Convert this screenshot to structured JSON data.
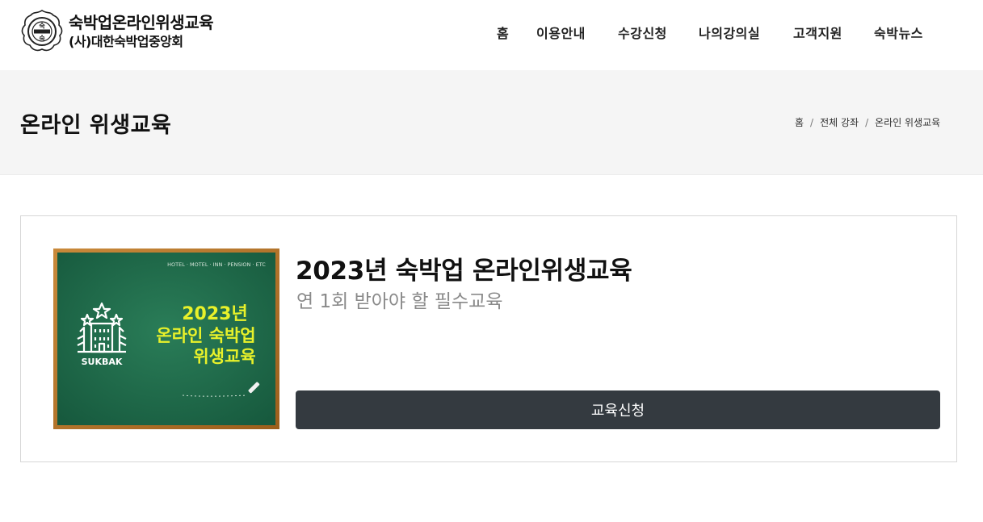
{
  "header": {
    "logo": {
      "line1": "숙박업온라인위생교육",
      "line2": "(사)대한숙박업중앙회",
      "emblem_text": "숙"
    },
    "nav": [
      {
        "label": "홈"
      },
      {
        "label": "이용안내"
      },
      {
        "label": "수강신청"
      },
      {
        "label": "나의강의실"
      },
      {
        "label": "고객지원"
      },
      {
        "label": "숙박뉴스"
      }
    ]
  },
  "page": {
    "title": "온라인 위생교육",
    "breadcrumb": [
      "홈",
      "전체 강좌",
      "온라인 위생교육"
    ]
  },
  "course": {
    "title": "2023년 숙박업 온라인위생교육",
    "subtitle": "연 1회 받아야 할 필수교육",
    "button_label": "교육신청",
    "thumbnail": {
      "top_text": "HOTEL · MOTEL · INN · PENSION · ETC",
      "line1": "2023년",
      "line2": "온라인 숙박업",
      "line3": "위생교육",
      "brand": "SUKBAK"
    }
  },
  "colors": {
    "button_bg": "#343a40",
    "titlebar_bg": "#f5f5f5",
    "board_green": "#1f6b4c",
    "board_frame": "#b8762a",
    "board_text": "#e8f12a"
  }
}
